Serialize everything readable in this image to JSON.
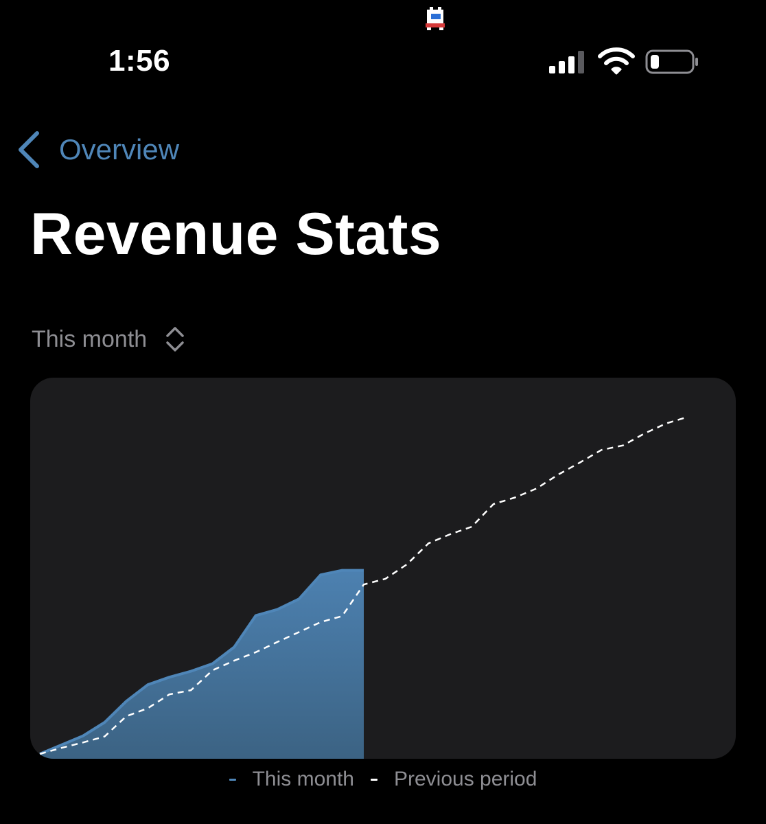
{
  "status_bar": {
    "time": "1:56",
    "icons": [
      "app-icon",
      "cellular-signal-icon",
      "wifi-icon",
      "battery-icon"
    ]
  },
  "navigation": {
    "back_label": "Overview",
    "back_icon": "chevron-left-icon"
  },
  "page": {
    "title": "Revenue Stats"
  },
  "period_selector": {
    "selected": "This month",
    "icon": "chevron-updown-icon"
  },
  "legend": {
    "items": [
      {
        "label": "This month",
        "color": "#4f86b8"
      },
      {
        "label": "Previous period",
        "color": "#ffffff"
      }
    ]
  },
  "colors": {
    "background": "#000000",
    "card": "#1c1c1e",
    "accent": "#4f86b8",
    "secondary_text": "#8e8e93"
  },
  "chart_data": {
    "type": "area",
    "x": [
      1,
      2,
      3,
      4,
      5,
      6,
      7,
      8,
      9,
      10,
      11,
      12,
      13,
      14,
      15,
      16,
      17,
      18,
      19,
      20,
      21,
      22,
      23,
      24,
      25,
      26,
      27,
      28,
      29,
      30,
      31
    ],
    "series": [
      {
        "name": "This month",
        "style": "filled-area",
        "color": "#4f86b8",
        "values": [
          0.0,
          0.3,
          0.6,
          1.05,
          1.75,
          2.3,
          2.55,
          2.75,
          3.0,
          3.55,
          4.6,
          4.8,
          5.15,
          5.95,
          6.1,
          6.1
        ]
      },
      {
        "name": "Previous period",
        "style": "dashed",
        "color": "#ffffff",
        "values": [
          0.0,
          0.2,
          0.38,
          0.58,
          1.25,
          1.52,
          1.98,
          2.12,
          2.78,
          3.1,
          3.38,
          3.72,
          4.05,
          4.38,
          4.58,
          5.63,
          5.82,
          6.3,
          7.0,
          7.3,
          7.55,
          8.3,
          8.52,
          8.82,
          9.28,
          9.68,
          10.1,
          10.25,
          10.65,
          10.98,
          11.2
        ]
      }
    ],
    "ylim": [
      0,
      12
    ],
    "grid": false,
    "legend": "bottom-center"
  }
}
